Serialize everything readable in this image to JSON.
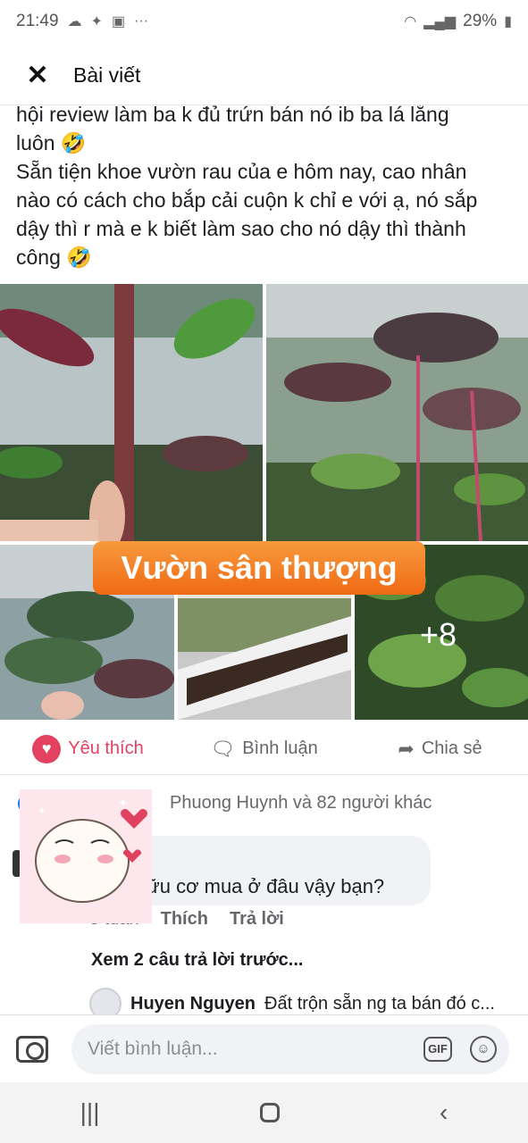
{
  "status_bar": {
    "time": "21:49",
    "battery": "29%"
  },
  "header": {
    "title": "Bài viết"
  },
  "post": {
    "lines": [
      "hội review làm ba k đủ trứn bán nó ib ba lá lắng",
      "luôn 🤣",
      "Sẵn tiện khoe vườn rau của e hôm nay, cao nhân",
      "nào có cách cho bắp cải cuộn k chỉ e với ạ, nó sắp",
      "dậy thì r mà e k biết làm sao cho nó dậy thì thành",
      "công 🤣"
    ]
  },
  "photos": {
    "overlay_label": "Vườn sân thượng",
    "more_count": "+8"
  },
  "actions": {
    "like": "Yêu thích",
    "comment": "Bình luận",
    "share": "Chia sẻ"
  },
  "reactions": {
    "text": "Phuong Huynh và 82 người khác"
  },
  "comment": {
    "text": "ữu cơ mua ở đâu vậy bạn?",
    "time": "5 tuần",
    "like": "Thích",
    "reply": "Trả lời"
  },
  "see_previous": "Xem 2 câu trả lời trước...",
  "reply": {
    "author": "Huyen Nguyen",
    "text": "Đất trộn sẵn ng ta bán đó c..."
  },
  "composer": {
    "placeholder": "Viết bình luận...",
    "gif": "GIF"
  },
  "icons": {
    "close": "close-icon",
    "camera": "camera-icon",
    "gif": "gif-icon",
    "emoji": "emoji-icon"
  }
}
